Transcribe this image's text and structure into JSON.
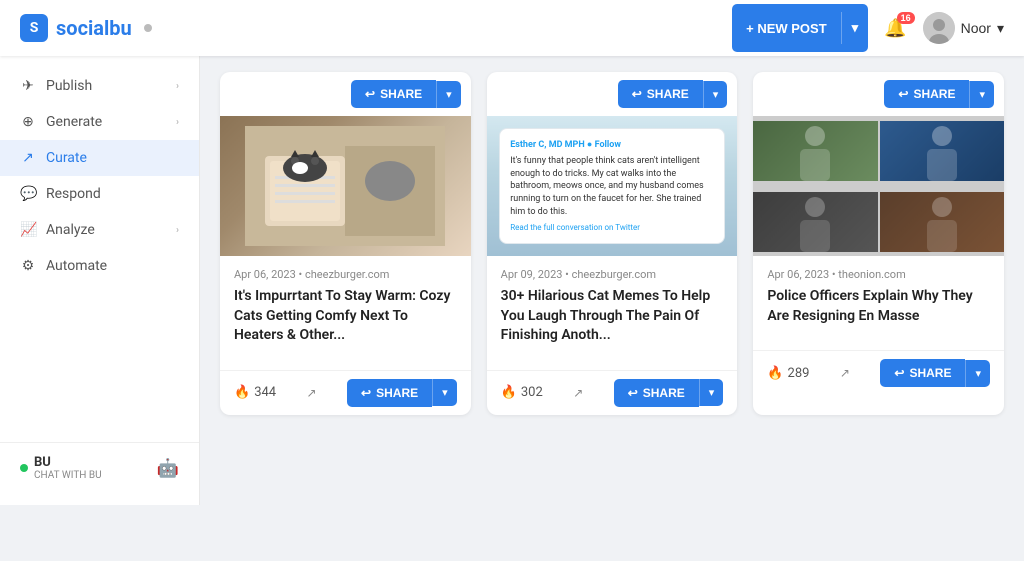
{
  "header": {
    "logo_text": "socialbu",
    "logo_dot": "●",
    "new_post_label": "+ NEW POST",
    "new_post_dropdown": "▾",
    "notification_count": "16",
    "user_name": "Noor",
    "user_chevron": "▾"
  },
  "sidebar": {
    "items": [
      {
        "id": "publish",
        "label": "Publish",
        "icon": "✈",
        "has_chevron": true,
        "active": false
      },
      {
        "id": "generate",
        "label": "Generate",
        "icon": "⊕",
        "has_chevron": true,
        "active": false
      },
      {
        "id": "curate",
        "label": "Curate",
        "icon": "↗",
        "has_chevron": false,
        "active": true
      },
      {
        "id": "respond",
        "label": "Respond",
        "icon": "💬",
        "has_chevron": false,
        "active": false
      },
      {
        "id": "analyze",
        "label": "Analyze",
        "icon": "📈",
        "has_chevron": true,
        "active": false
      },
      {
        "id": "automate",
        "label": "Automate",
        "icon": "⚙",
        "has_chevron": false,
        "active": false
      }
    ],
    "bottom": {
      "indicator_label": "BU",
      "chat_label": "CHAT WITH BU"
    }
  },
  "cards": [
    {
      "id": "card-1",
      "date": "Apr 06, 2023 • cheezburger.com",
      "title": "It's Impurrtant To Stay Warm: Cozy Cats Getting Comfy Next To Heaters & Other...",
      "score": "344",
      "image_type": "cat-heater",
      "share_label": "SHARE"
    },
    {
      "id": "card-2",
      "date": "Apr 09, 2023 • cheezburger.com",
      "title": "30+ Hilarious Cat Memes To Help You Laugh Through The Pain Of Finishing Anoth...",
      "score": "302",
      "image_type": "tweet",
      "tweet_author": "Esther C, MD MPH ● Follow",
      "tweet_text": "It's funny that people think cats aren't intelligent enough to do tricks. My cat walks into the bathroom, meows once, and my husband comes running to turn on the faucet for her. She trained him to do this.",
      "tweet_link": "Read the full conversation on Twitter",
      "share_label": "SHARE"
    },
    {
      "id": "card-3",
      "date": "Apr 06, 2023 • theonion.com",
      "title": "Police Officers Explain Why They Are Resigning En Masse",
      "score": "289",
      "image_type": "photo-grid",
      "share_label": "SHARE"
    }
  ],
  "icons": {
    "share": "↩",
    "fire": "🔥",
    "external": "↗",
    "chevron_right": "›",
    "chevron_down": "▾",
    "bell": "🔔",
    "plus": "+",
    "robot": "🤖"
  }
}
